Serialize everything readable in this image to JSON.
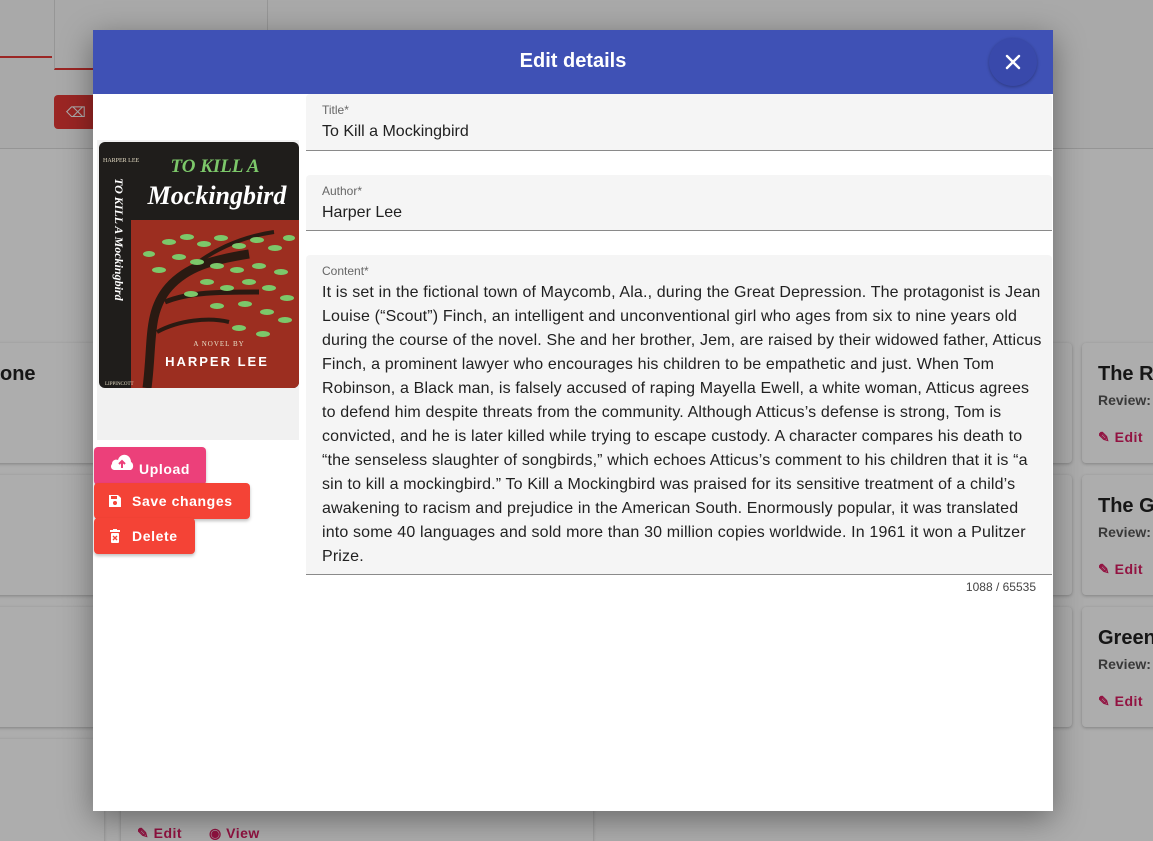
{
  "dialog": {
    "title": "Edit details",
    "fields": {
      "title": {
        "label": "Title*",
        "value": "To Kill a Mockingbird"
      },
      "author": {
        "label": "Author*",
        "value": "Harper Lee"
      },
      "content": {
        "label": "Content*",
        "value": "It is set in the fictional town of Maycomb, Ala., during the Great Depression. The protagonist is Jean Louise (“Scout”) Finch, an intelligent and unconventional girl who ages from six to nine years old during the course of the novel. She and her brother, Jem, are raised by their widowed father, Atticus Finch, a prominent lawyer who encourages his children to be empathetic and just. When Tom Robinson, a Black man, is falsely accused of raping Mayella Ewell, a white woman, Atticus agrees to defend him despite threats from the community. Although Atticus’s defense is strong, Tom is convicted, and he is later killed while trying to escape custody. A character compares his death to “the senseless slaughter of songbirds,” which echoes Atticus’s comment to his children that it is “a sin to kill a mockingbird.” To Kill a Mockingbird was praised for its sensitive treatment of a child’s awakening to racism and prejudice in the American South. Enormously popular, it was translated into some 40 languages and sold more than 30 million copies worldwide. In 1961 it won a Pulitzer Prize.",
        "counter": "1088 / 65535"
      }
    },
    "cover": {
      "title_line1": "TO KILL A",
      "title_line2": "Mockingbird",
      "author_small": "HARPER LEE",
      "spine_text": "TO KILL A Mockingbird",
      "subtitle": "A NOVEL BY",
      "author": "HARPER LEE",
      "publisher": "LIPPINCOTT"
    },
    "buttons": {
      "upload": "Upload",
      "save": "Save changes",
      "delete": "Delete"
    },
    "icons": {
      "close": "close-icon",
      "upload": "cloud-upload-icon",
      "save": "save-icon",
      "delete": "delete-icon"
    }
  },
  "background": {
    "cards": [
      {
        "title": "one"
      },
      {
        "title": "The Ro",
        "review": "Review: C",
        "edit": "Edit"
      },
      {
        "title": "The G",
        "review": "Review: C",
        "edit": "Edit"
      },
      {
        "title": "Green",
        "review": "Review: C",
        "edit": "Edit"
      }
    ],
    "bottom_card": {
      "edit": "Edit",
      "view": "View"
    }
  },
  "colors": {
    "header": "#3f51b5",
    "upload": "#ec407a",
    "danger": "#f44336",
    "accent": "#d81b60"
  }
}
